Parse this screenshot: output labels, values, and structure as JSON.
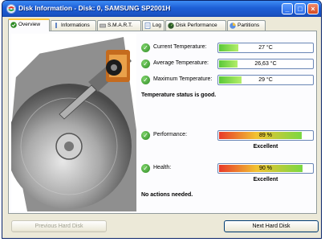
{
  "window": {
    "title": "Disk Information - Disk: 0, SAMSUNG SP2001H",
    "min_glyph": "_",
    "max_glyph": "□",
    "close_glyph": "×"
  },
  "tabs": [
    {
      "label": "Overview",
      "icon": "check-icon",
      "active": true
    },
    {
      "label": "Informations",
      "icon": "info-icon"
    },
    {
      "label": "S.M.A.R.T.",
      "icon": "drive-icon"
    },
    {
      "label": "Log",
      "icon": "log-icon"
    },
    {
      "label": "Disk Performance",
      "icon": "gauge-icon"
    },
    {
      "label": "Partitions",
      "icon": "pie-icon"
    }
  ],
  "metrics": {
    "current_temp": {
      "label": "Current Temperature:",
      "value": "27 °C",
      "level": 0.22
    },
    "average_temp": {
      "label": "Average Temperature:",
      "value": "26,63 °C",
      "level": 0.21
    },
    "maximum_temp": {
      "label": "Maximum Temperature:",
      "value": "29 °C",
      "level": 0.25
    },
    "performance": {
      "label": "Performance:",
      "value": "89 %",
      "level": 0.89
    },
    "health": {
      "label": "Health:",
      "value": "90 %",
      "level": 0.9
    }
  },
  "status": {
    "temperature": "Temperature status is good.",
    "performance_verdict": "Excellent",
    "health_verdict": "Excellent",
    "actions": "No actions needed."
  },
  "buttons": {
    "prev": "Previous Hard Disk",
    "next": "Next Hard Disk"
  },
  "colors": {
    "ok_green": "#2e8b24",
    "titlebar_blue": "#1d5fd6",
    "tab_highlight": "#ffc83c"
  }
}
